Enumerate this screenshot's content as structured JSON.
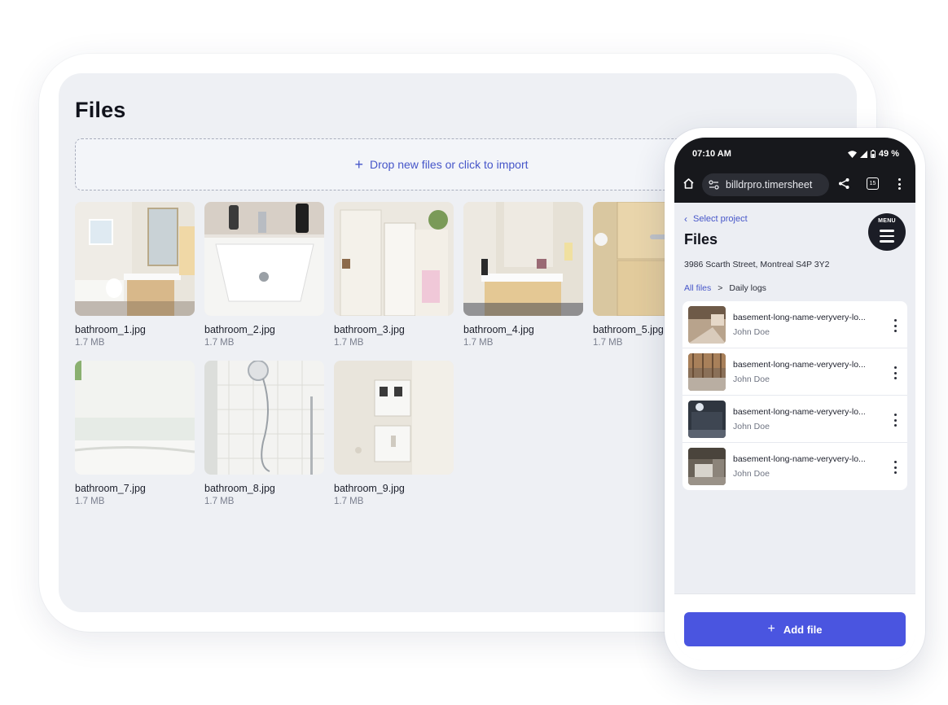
{
  "tablet": {
    "title": "Files",
    "dropzone": {
      "icon": "plus-icon",
      "label": "Drop new files or click to import"
    },
    "files": [
      {
        "name": "bathroom_1.jpg",
        "size": "1.7 MB"
      },
      {
        "name": "bathroom_2.jpg",
        "size": "1.7 MB"
      },
      {
        "name": "bathroom_3.jpg",
        "size": "1.7 MB"
      },
      {
        "name": "bathroom_4.jpg",
        "size": "1.7 MB"
      },
      {
        "name": "bathroom_5.jpg",
        "size": "1.7 MB"
      },
      {
        "name": "bathroom_7.jpg",
        "size": "1.7 MB"
      },
      {
        "name": "bathroom_8.jpg",
        "size": "1.7 MB"
      },
      {
        "name": "bathroom_9.jpg",
        "size": "1.7 MB"
      }
    ]
  },
  "phone": {
    "status": {
      "time": "07:10 AM",
      "battery": "49 %"
    },
    "browser": {
      "url": "billdrpro.timersheet",
      "tab_count": "15"
    },
    "back_label": "Select project",
    "menu_label": "MENU",
    "title": "Files",
    "address": "3986 Scarth Street, Montreal S4P 3Y2",
    "breadcrumb": {
      "root": "All files",
      "separator": ">",
      "current": "Daily logs"
    },
    "files": [
      {
        "name": "basement-long-name-veryvery-lo...",
        "owner": "John Doe"
      },
      {
        "name": "basement-long-name-veryvery-lo...",
        "owner": "John Doe"
      },
      {
        "name": "basement-long-name-veryvery-lo...",
        "owner": "John Doe"
      },
      {
        "name": "basement-long-name-veryvery-lo...",
        "owner": "John Doe"
      }
    ],
    "add_button": "Add file"
  },
  "colors": {
    "accent": "#4a55e0",
    "link": "#4656c9",
    "dark": "#17181c"
  }
}
